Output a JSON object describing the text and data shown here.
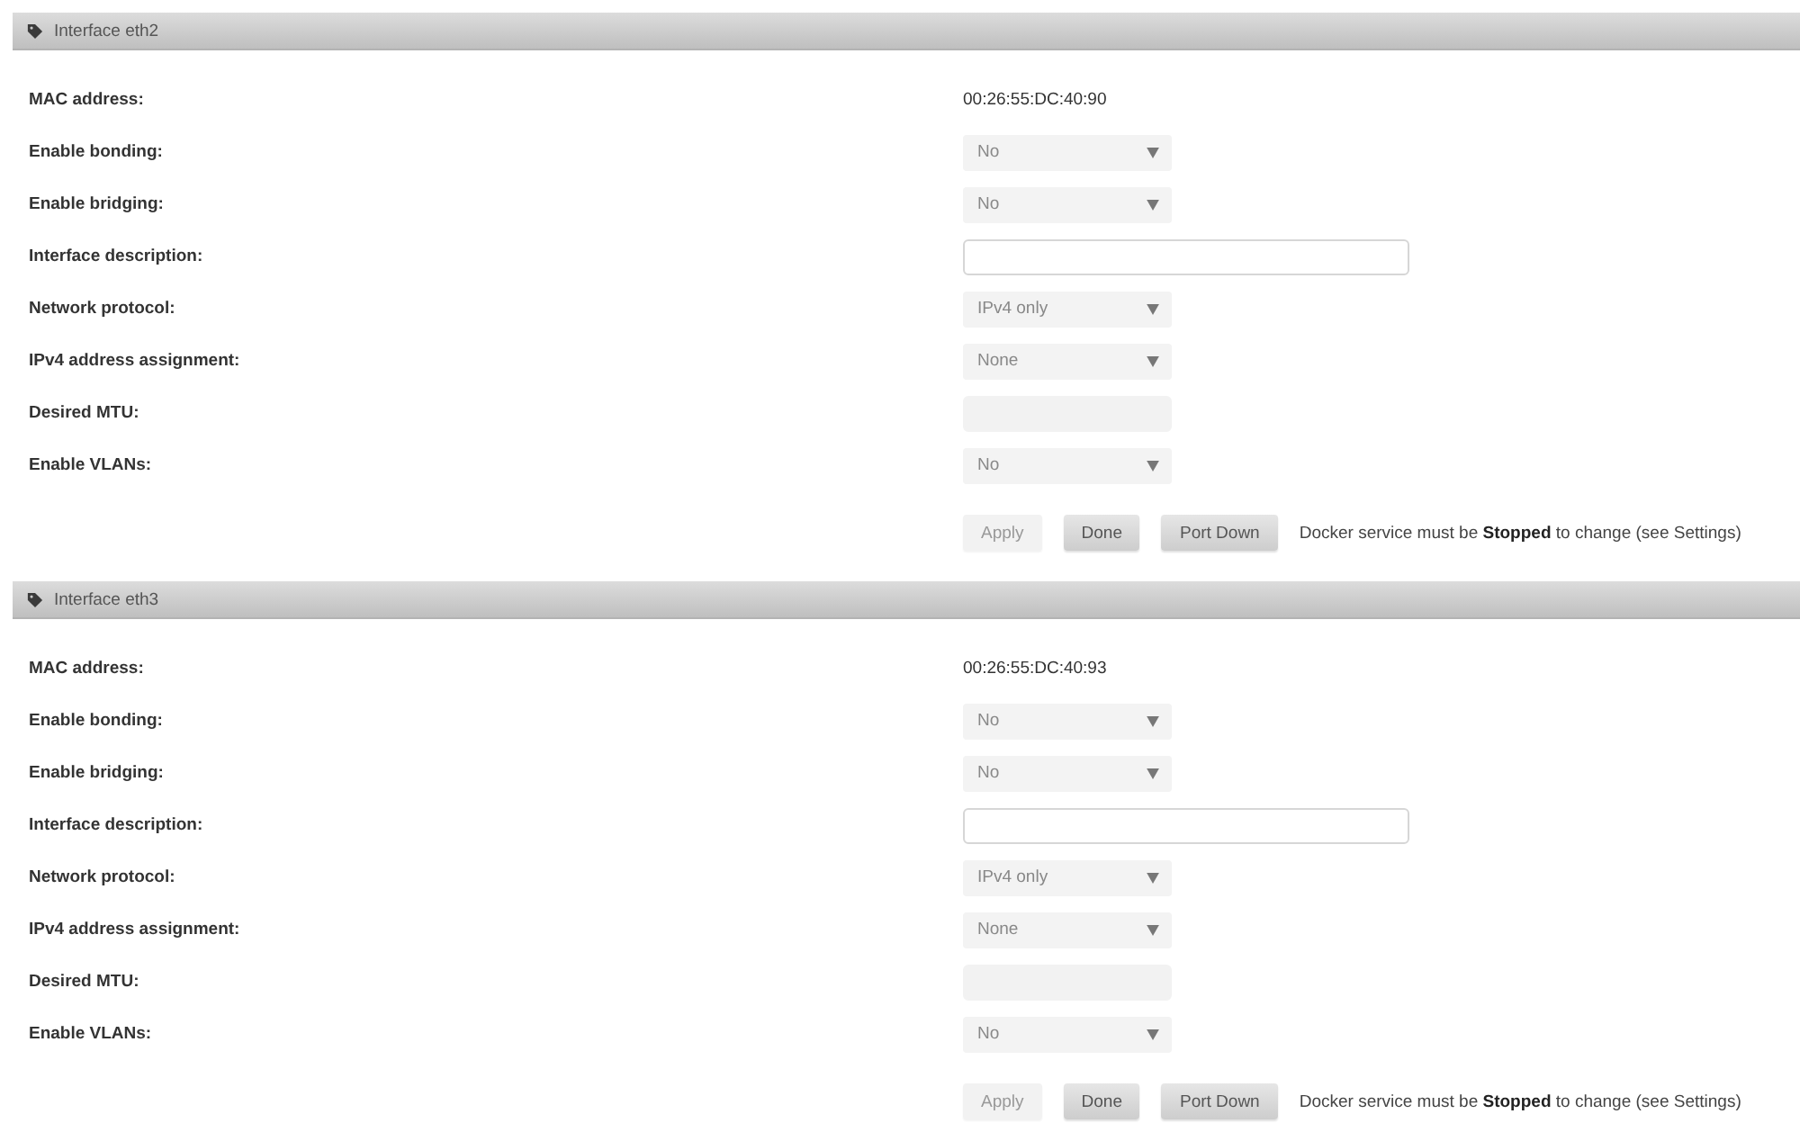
{
  "panels": [
    {
      "title": "Interface eth2",
      "fields": [
        {
          "label": "MAC address:",
          "kind": "static",
          "value": "00:26:55:DC:40:90"
        },
        {
          "label": "Enable bonding:",
          "kind": "select",
          "value": "No"
        },
        {
          "label": "Enable bridging:",
          "kind": "select",
          "value": "No"
        },
        {
          "label": "Interface description:",
          "kind": "text",
          "disabled": false
        },
        {
          "label": "Network protocol:",
          "kind": "select",
          "value": "IPv4 only"
        },
        {
          "label": "IPv4 address assignment:",
          "kind": "select",
          "value": "None"
        },
        {
          "label": "Desired MTU:",
          "kind": "number",
          "disabled": true
        },
        {
          "label": "Enable VLANs:",
          "kind": "select",
          "value": "No"
        }
      ],
      "buttons": [
        {
          "label": "Apply",
          "disabled": true
        },
        {
          "label": "Done",
          "disabled": false
        },
        {
          "label": "Port Down",
          "disabled": false
        }
      ],
      "note": "Docker service must be **Stopped** to change (see Settings)"
    },
    {
      "title": "Interface eth3",
      "fields": [
        {
          "label": "MAC address:",
          "kind": "static",
          "value": "00:26:55:DC:40:93"
        },
        {
          "label": "Enable bonding:",
          "kind": "select",
          "value": "No"
        },
        {
          "label": "Enable bridging:",
          "kind": "select",
          "value": "No"
        },
        {
          "label": "Interface description:",
          "kind": "text",
          "disabled": false
        },
        {
          "label": "Network protocol:",
          "kind": "select",
          "value": "IPv4 only"
        },
        {
          "label": "IPv4 address assignment:",
          "kind": "select",
          "value": "None"
        },
        {
          "label": "Desired MTU:",
          "kind": "number",
          "disabled": true
        },
        {
          "label": "Enable VLANs:",
          "kind": "select",
          "value": "No"
        }
      ],
      "buttons": [
        {
          "label": "Apply",
          "disabled": true
        },
        {
          "label": "Done",
          "disabled": false
        },
        {
          "label": "Port Down",
          "disabled": false
        }
      ],
      "note": "Docker service must be **Stopped** to change (see Settings)"
    }
  ]
}
